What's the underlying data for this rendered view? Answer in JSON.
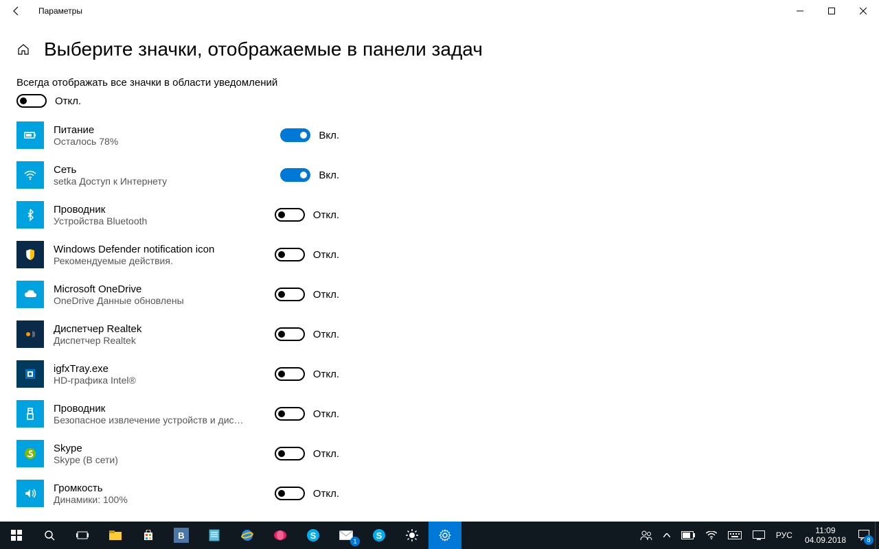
{
  "window": {
    "title": "Параметры"
  },
  "page": {
    "title": "Выберите значки, отображаемые в панели задач"
  },
  "master": {
    "label": "Всегда отображать все значки в области уведомлений",
    "state_text": "Откл.",
    "on": false
  },
  "labels": {
    "on": "Вкл.",
    "off": "Откл."
  },
  "items": [
    {
      "title": "Питание",
      "sub": "Осталось 78%",
      "on": true,
      "icon": "battery"
    },
    {
      "title": "Сеть",
      "sub": "setka Доступ к Интернету",
      "on": true,
      "icon": "wifi"
    },
    {
      "title": "Проводник",
      "sub": "Устройства Bluetooth",
      "on": false,
      "icon": "bluetooth"
    },
    {
      "title": "Windows Defender notification icon",
      "sub": "Рекомендуемые действия.",
      "on": false,
      "icon": "shield"
    },
    {
      "title": "Microsoft OneDrive",
      "sub": "OneDrive Данные обновлены",
      "on": false,
      "icon": "cloud"
    },
    {
      "title": "Диспетчер Realtek",
      "sub": "Диспетчер Realtek",
      "on": false,
      "icon": "speaker-dark"
    },
    {
      "title": "igfxTray.exe",
      "sub": "HD-графика Intel®",
      "on": false,
      "icon": "intel"
    },
    {
      "title": "Проводник",
      "sub": "Безопасное извлечение устройств и дис…",
      "on": false,
      "icon": "usb"
    },
    {
      "title": "Skype",
      "sub": "Skype (В сети)",
      "on": false,
      "icon": "skype"
    },
    {
      "title": "Громкость",
      "sub": "Динамики: 100%",
      "on": false,
      "icon": "volume"
    }
  ],
  "taskbar": {
    "pinned": [
      "start",
      "search",
      "taskview",
      "explorer",
      "store",
      "vk",
      "note",
      "ie",
      "browser",
      "skype1",
      "mail",
      "skype2",
      "brightness",
      "settings"
    ],
    "mail_badge": "1",
    "tray": {
      "lang": "РУС",
      "time": "11:09",
      "date": "04.09.2018",
      "notif_badge": "8"
    }
  }
}
